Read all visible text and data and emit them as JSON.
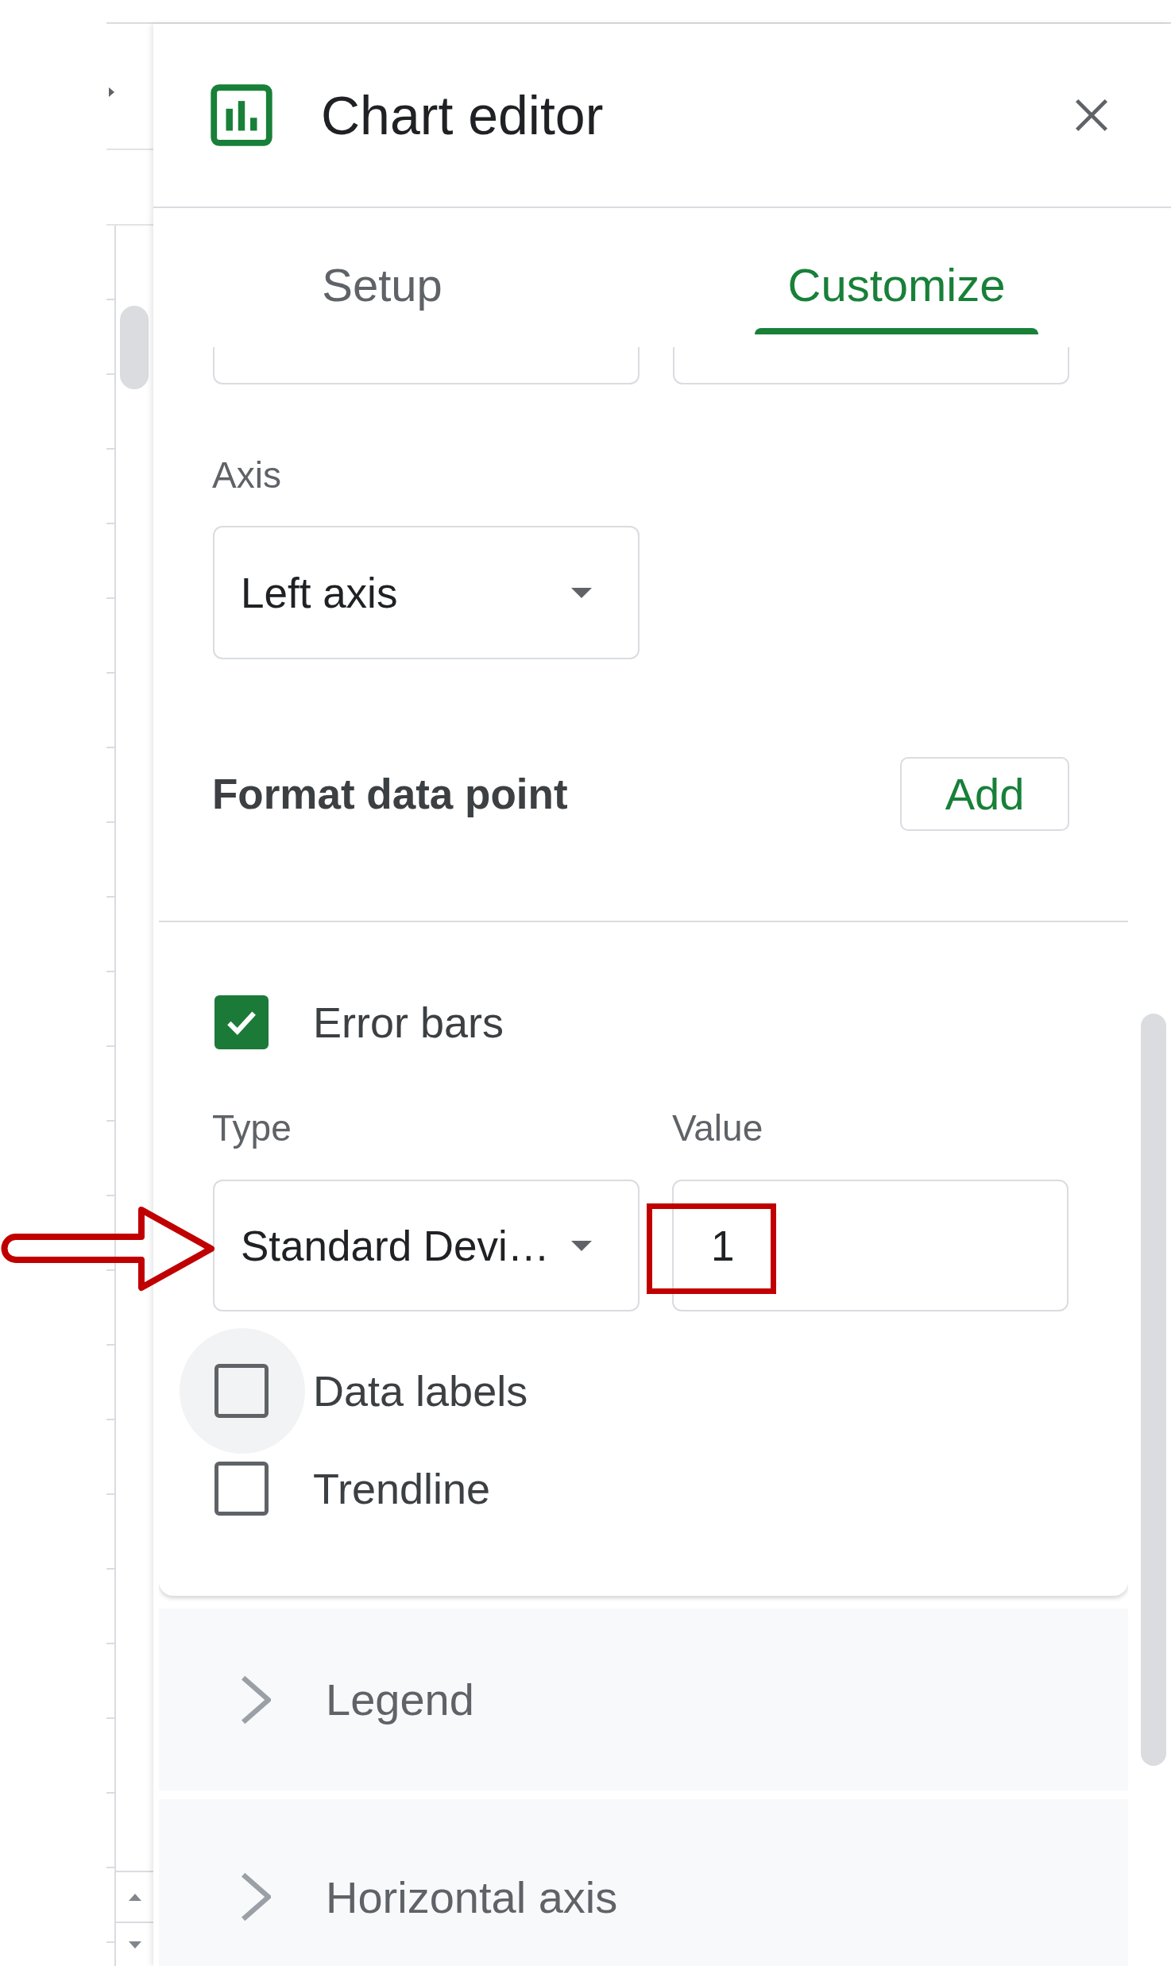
{
  "editor": {
    "title": "Chart editor"
  },
  "tabs": [
    {
      "label": "Setup",
      "selected": false
    },
    {
      "label": "Customize",
      "selected": true
    }
  ],
  "axis": {
    "label": "Axis",
    "value": "Left axis"
  },
  "format_data_point": {
    "label": "Format data point",
    "button": "Add"
  },
  "error_bars": {
    "label": "Error bars",
    "checked": true,
    "type": {
      "label": "Type",
      "value": "Standard Devi…"
    },
    "value": {
      "label": "Value",
      "value": "1"
    }
  },
  "checkboxes": [
    {
      "label": "Data labels",
      "checked": false,
      "focused": true
    },
    {
      "label": "Trendline",
      "checked": false,
      "focused": false
    }
  ],
  "sections": [
    {
      "label": "Legend",
      "expanded": false
    },
    {
      "label": "Horizontal axis",
      "expanded": false
    }
  ],
  "annotations": {
    "arrow": true,
    "frame": true
  }
}
